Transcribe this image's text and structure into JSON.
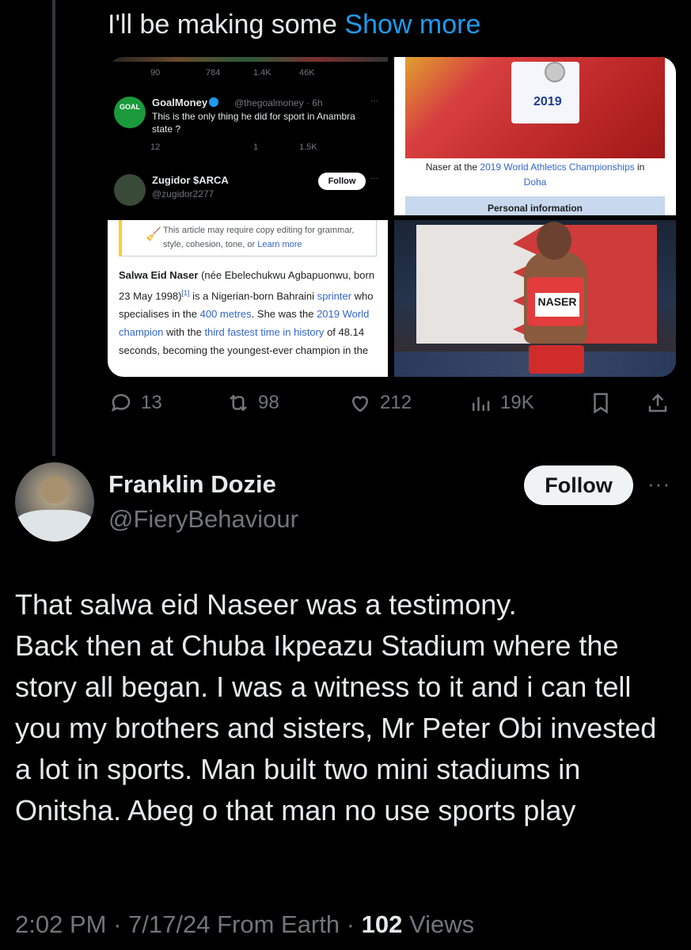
{
  "quoted_tweet": {
    "truncated_text": "I'll be making some",
    "show_more_label": "Show more",
    "media": {
      "nested_screenshot": {
        "top_stats": [
          "90",
          "784",
          "1.4K",
          "46K"
        ],
        "goalmoney": {
          "name": "GoalMoney",
          "handle": "@thegoalmoney",
          "time": "6h",
          "avatar_text": "GOAL",
          "text": "This is the only thing he did for sport in Anambra state ?",
          "stats": [
            "12",
            "",
            "1",
            "1.5K"
          ]
        },
        "zugidor": {
          "name": "Zugidor $ARCA",
          "handle": "@zugidor2277",
          "follow_label": "Follow"
        },
        "dots": "···"
      },
      "wiki_caption": {
        "bib_text": "2019",
        "caption_prefix": "Naser at the",
        "caption_link": "2019 World Athletics Championships",
        "caption_mid": "in",
        "caption_link2": "Doha",
        "personal_info": "Personal information"
      },
      "wiki_article": {
        "notice_text": "This article may require copy editing for grammar, style, cohesion, tone, or",
        "learn_more": "Learn more",
        "name_bold": "Salwa Eid Naser",
        "t1": "(née Ebelechukwu Agbapuonwu, born 23 May 1998)",
        "ref": "[1]",
        "t2": "is a Nigerian-born Bahraini",
        "link_sprinter": "sprinter",
        "t3": "who specialises in the",
        "link_400": "400 metres",
        "t4": ". She was the",
        "link_champion": "2019 World champion",
        "t5": "with the",
        "link_fastest": "third fastest time in history",
        "t6": "of 48.14 seconds, becoming the youngest-ever champion in the"
      },
      "athlete_photo": {
        "bib_text": "NASER"
      }
    },
    "actions": {
      "replies": "13",
      "reposts": "98",
      "likes": "212",
      "views": "19K"
    }
  },
  "reply": {
    "name": "Franklin Dozie",
    "handle": "@FieryBehaviour",
    "follow_label": "Follow",
    "more_label": "···",
    "text": "That salwa eid Naseer was a testimony.\nBack then at Chuba Ikpeazu Stadium where the story all began. I was a witness to it and i can tell you my brothers and sisters, Mr Peter Obi invested a lot in sports. Man built two mini stadiums in Onitsha. Abeg o that man no use sports play",
    "time": "2:02 PM",
    "date": "7/17/24",
    "source": "From Earth",
    "views_count": "102",
    "views_label": "Views"
  }
}
